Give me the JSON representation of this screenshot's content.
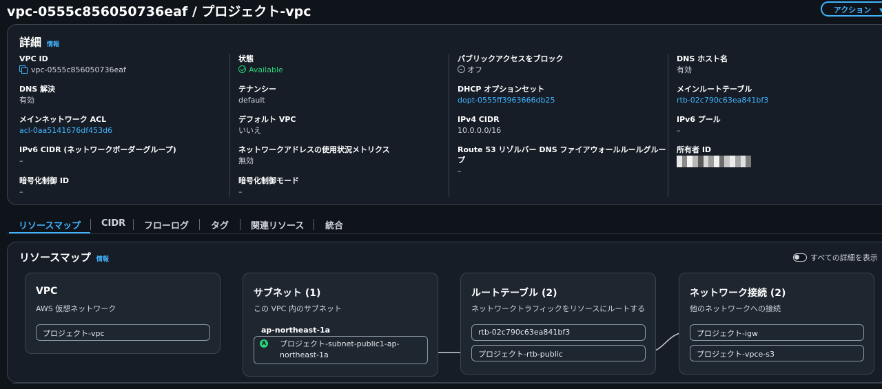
{
  "header": {
    "title": "vpc-0555c856050736eaf / プロジェクト-vpc",
    "action_label": "アクション"
  },
  "details": {
    "heading": "詳細",
    "info": "情報",
    "vpc_id": {
      "label": "VPC ID",
      "value": "vpc-0555c856050736eaf"
    },
    "dns_resolution": {
      "label": "DNS 解決",
      "value": "有効"
    },
    "main_acl": {
      "label": "メインネットワーク ACL",
      "value": "acl-0aa5141676df453d6"
    },
    "ipv6_cidr_group": {
      "label": "IPv6 CIDR (ネットワークボーダーグループ)",
      "value": "–"
    },
    "encryption_id": {
      "label": "暗号化制御 ID",
      "value": "–"
    },
    "state": {
      "label": "状態",
      "value": "Available"
    },
    "tenancy": {
      "label": "テナンシー",
      "value": "default"
    },
    "default_vpc": {
      "label": "デフォルト VPC",
      "value": "いいえ"
    },
    "address_metrics": {
      "label": "ネットワークアドレスの使用状況メトリクス",
      "value": "無効"
    },
    "encryption_mode": {
      "label": "暗号化制御モード",
      "value": "–"
    },
    "block_public": {
      "label": "パブリックアクセスをブロック",
      "value": "オフ"
    },
    "dhcp": {
      "label": "DHCP オプションセット",
      "value": "dopt-0555ff3963666db25"
    },
    "ipv4_cidr": {
      "label": "IPv4 CIDR",
      "value": "10.0.0.0/16"
    },
    "route53": {
      "label_line1": "Route 53 リゾルバー DNS ファイアウォールルールグルー",
      "label_line2": "プ",
      "value": "–"
    },
    "dns_hostnames": {
      "label": "DNS ホスト名",
      "value": "有効"
    },
    "main_route_table": {
      "label": "メインルートテーブル",
      "value": "rtb-02c790c63ea841bf3"
    },
    "ipv6_pool": {
      "label": "IPv6 プール",
      "value": "–"
    },
    "owner_id": {
      "label": "所有者 ID"
    }
  },
  "tabs": [
    "リソースマップ",
    "CIDR",
    "フローログ",
    "タグ",
    "関連リソース",
    "統合"
  ],
  "resource_map": {
    "heading": "リソースマップ",
    "info": "情報",
    "toggle_label": "すべての詳細を表示",
    "vpc_card": {
      "title": "VPC",
      "subtitle": "AWS 仮想ネットワーク",
      "items": [
        "プロジェクト-vpc"
      ]
    },
    "subnet_card": {
      "title": "サブネット (1)",
      "subtitle": "この VPC 内のサブネット",
      "az": "ap-northeast-1a",
      "badge": "A",
      "subnet_line1": "プロジェクト-subnet-public1-ap-",
      "subnet_line2": "northeast-1a"
    },
    "route_card": {
      "title": "ルートテーブル (2)",
      "subtitle": "ネットワークトラフィックをリソースにルートする",
      "items": [
        "rtb-02c790c63ea841bf3",
        "プロジェクト-rtb-public"
      ]
    },
    "network_card": {
      "title": "ネットワーク接続 (2)",
      "subtitle": "他のネットワークへの接続",
      "items": [
        "プロジェクト-igw",
        "プロジェクト-vpce-s3"
      ]
    }
  },
  "colors": {
    "accent": "#42b4ff",
    "success": "#29d17a",
    "background": "#0f141a",
    "panel": "#161d26"
  }
}
